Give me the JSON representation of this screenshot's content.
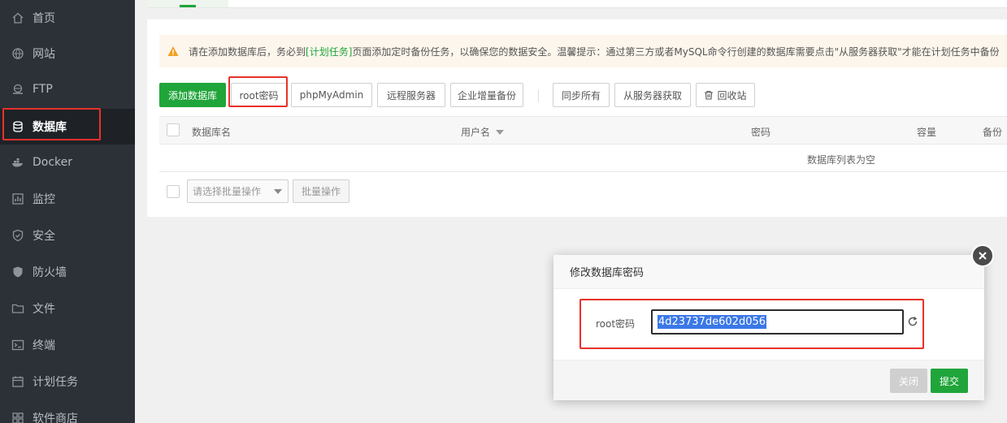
{
  "sidebar": {
    "items": [
      {
        "label": "首页",
        "icon": "home-icon"
      },
      {
        "label": "网站",
        "icon": "globe-icon"
      },
      {
        "label": "FTP",
        "icon": "ftp-icon"
      },
      {
        "label": "数据库",
        "icon": "database-icon",
        "active": true
      },
      {
        "label": "Docker",
        "icon": "docker-icon"
      },
      {
        "label": "监控",
        "icon": "monitor-icon"
      },
      {
        "label": "安全",
        "icon": "shield-icon"
      },
      {
        "label": "防火墙",
        "icon": "firewall-icon"
      },
      {
        "label": "文件",
        "icon": "folder-icon"
      },
      {
        "label": "终端",
        "icon": "terminal-icon"
      },
      {
        "label": "计划任务",
        "icon": "calendar-icon"
      },
      {
        "label": "软件商店",
        "icon": "store-icon"
      }
    ]
  },
  "warning": {
    "text_before": "请在添加数据库后，务必到",
    "link": "[计划任务]",
    "text_after": "页面添加定时备份任务，以确保您的数据安全。温馨提示：通过第三方或者MySQL命令行创建的数据库需要点击\"从服务器获取\"才能在计划任务中备份"
  },
  "toolbar": {
    "add_db": "添加数据库",
    "root_password": "root密码",
    "phpmyadmin": "phpMyAdmin",
    "remote_server": "远程服务器",
    "enterprise_backup": "企业增量备份",
    "sync_all": "同步所有",
    "fetch_from_server": "从服务器获取",
    "recycle_bin": "回收站"
  },
  "table": {
    "columns": [
      "数据库名",
      "用户名",
      "密码",
      "容量",
      "备份"
    ],
    "empty_text": "数据库列表为空"
  },
  "batch": {
    "select_placeholder": "请选择批量操作",
    "button": "批量操作"
  },
  "modal": {
    "title": "修改数据库密码",
    "label": "root密码",
    "password_value": "4d23737de602d056",
    "close_label": "关闭",
    "submit_label": "提交"
  },
  "colors": {
    "accent": "#20a53a",
    "sidebar_bg": "#2c3138",
    "highlight_red": "#e8312a",
    "selection_blue": "#3b78e7"
  }
}
